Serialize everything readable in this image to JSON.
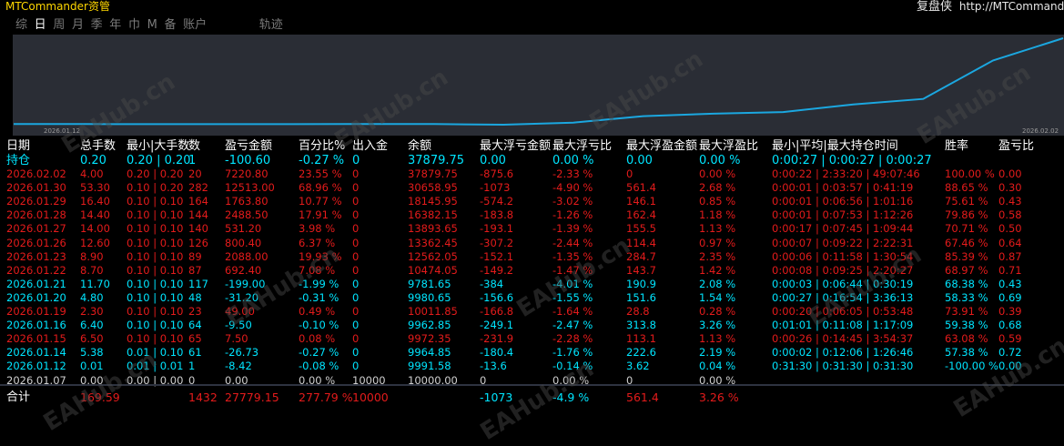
{
  "app": {
    "title": "MTCommander资管"
  },
  "brand": {
    "name": "复盘侠",
    "url": "http://MTCommand"
  },
  "tabs": [
    "综",
    "日",
    "周",
    "月",
    "季",
    "年",
    "巾",
    "M",
    "备",
    "账户"
  ],
  "tabs_active": "日",
  "trail_label": "轨迹",
  "equity_chart": {
    "start_date": "2026.01.12",
    "end_date": "2026.02.02",
    "line_color": "#1ba7e0",
    "points": [
      10000.0,
      9991.58,
      9964.85,
      9972.35,
      9962.85,
      10011.85,
      9980.65,
      9781.65,
      10474.05,
      12562.05,
      13362.45,
      13893.65,
      16382.15,
      18145.95,
      30658.95,
      37879.75
    ]
  },
  "table": {
    "headers": [
      "日期",
      "总手数",
      "最小|大手数",
      "数",
      "盈亏金额",
      "百分比%",
      "出入金",
      "余额",
      "最大浮亏金额",
      "最大浮亏比",
      "最大浮盈金额",
      "最大浮盈比",
      "最小|平均|最大持仓时间",
      "胜率",
      "盈亏比"
    ],
    "holding": {
      "date": "持仓",
      "lots": "0.20",
      "minmax": "0.20 | 0.20",
      "count": "1",
      "pnl": "-100.60",
      "pct": "-0.27 %",
      "flow": "0",
      "balance": "37879.75",
      "max_dd_amt": "0.00",
      "max_dd_pct": "0.00 %",
      "max_fp_amt": "0.00",
      "max_fp_pct": "0.00 %",
      "hold_time": "0:00:27 | 0:00:27 | 0:00:27",
      "win": "",
      "pf": ""
    },
    "rows": [
      {
        "date": "2026.02.02",
        "lots": "4.00",
        "minmax": "0.20 | 0.20",
        "count": "20",
        "pnl": "7220.80",
        "pct": "23.55 %",
        "flow": "0",
        "balance": "37879.75",
        "max_dd_amt": "-875.6",
        "max_dd_pct": "-2.33 %",
        "max_fp_amt": "0",
        "max_fp_pct": "0.00 %",
        "hold_time": "0:00:22 | 2:33:20 | 49:07:46",
        "win": "100.00 %",
        "pf": "0.00",
        "tone": "neg"
      },
      {
        "date": "2026.01.30",
        "lots": "53.30",
        "minmax": "0.10 | 0.20",
        "count": "282",
        "pnl": "12513.00",
        "pct": "68.96 %",
        "flow": "0",
        "balance": "30658.95",
        "max_dd_amt": "-1073",
        "max_dd_pct": "-4.90 %",
        "max_fp_amt": "561.4",
        "max_fp_pct": "2.68 %",
        "hold_time": "0:00:01 | 0:03:57 | 0:41:19",
        "win": "88.65 %",
        "pf": "0.30",
        "tone": "neg"
      },
      {
        "date": "2026.01.29",
        "lots": "16.40",
        "minmax": "0.10 | 0.10",
        "count": "164",
        "pnl": "1763.80",
        "pct": "10.77 %",
        "flow": "0",
        "balance": "18145.95",
        "max_dd_amt": "-574.2",
        "max_dd_pct": "-3.02 %",
        "max_fp_amt": "146.1",
        "max_fp_pct": "0.85 %",
        "hold_time": "0:00:01 | 0:06:56 | 1:01:16",
        "win": "75.61 %",
        "pf": "0.43",
        "tone": "neg"
      },
      {
        "date": "2026.01.28",
        "lots": "14.40",
        "minmax": "0.10 | 0.10",
        "count": "144",
        "pnl": "2488.50",
        "pct": "17.91 %",
        "flow": "0",
        "balance": "16382.15",
        "max_dd_amt": "-183.8",
        "max_dd_pct": "-1.26 %",
        "max_fp_amt": "162.4",
        "max_fp_pct": "1.18 %",
        "hold_time": "0:00:01 | 0:07:53 | 1:12:26",
        "win": "79.86 %",
        "pf": "0.58",
        "tone": "neg"
      },
      {
        "date": "2026.01.27",
        "lots": "14.00",
        "minmax": "0.10 | 0.10",
        "count": "140",
        "pnl": "531.20",
        "pct": "3.98 %",
        "flow": "0",
        "balance": "13893.65",
        "max_dd_amt": "-193.1",
        "max_dd_pct": "-1.39 %",
        "max_fp_amt": "155.5",
        "max_fp_pct": "1.13 %",
        "hold_time": "0:00:17 | 0:07:45 | 1:09:44",
        "win": "70.71 %",
        "pf": "0.50",
        "tone": "neg"
      },
      {
        "date": "2026.01.26",
        "lots": "12.60",
        "minmax": "0.10 | 0.10",
        "count": "126",
        "pnl": "800.40",
        "pct": "6.37 %",
        "flow": "0",
        "balance": "13362.45",
        "max_dd_amt": "-307.2",
        "max_dd_pct": "-2.44 %",
        "max_fp_amt": "114.4",
        "max_fp_pct": "0.97 %",
        "hold_time": "0:00:07 | 0:09:22 | 2:22:31",
        "win": "67.46 %",
        "pf": "0.64",
        "tone": "neg"
      },
      {
        "date": "2026.01.23",
        "lots": "8.90",
        "minmax": "0.10 | 0.10",
        "count": "89",
        "pnl": "2088.00",
        "pct": "19.93 %",
        "flow": "0",
        "balance": "12562.05",
        "max_dd_amt": "-152.1",
        "max_dd_pct": "-1.35 %",
        "max_fp_amt": "284.7",
        "max_fp_pct": "2.35 %",
        "hold_time": "0:00:06 | 0:11:58 | 1:30:54",
        "win": "85.39 %",
        "pf": "0.87",
        "tone": "neg"
      },
      {
        "date": "2026.01.22",
        "lots": "8.70",
        "minmax": "0.10 | 0.10",
        "count": "87",
        "pnl": "692.40",
        "pct": "7.08 %",
        "flow": "0",
        "balance": "10474.05",
        "max_dd_amt": "-149.2",
        "max_dd_pct": "-1.47 %",
        "max_fp_amt": "143.7",
        "max_fp_pct": "1.42 %",
        "hold_time": "0:00:08 | 0:09:25 | 2:20:27",
        "win": "68.97 %",
        "pf": "0.71",
        "tone": "neg"
      },
      {
        "date": "2026.01.21",
        "lots": "11.70",
        "minmax": "0.10 | 0.10",
        "count": "117",
        "pnl": "-199.00",
        "pct": "-1.99 %",
        "flow": "0",
        "balance": "9781.65",
        "max_dd_amt": "-384",
        "max_dd_pct": "-4.01 %",
        "max_fp_amt": "190.9",
        "max_fp_pct": "2.08 %",
        "hold_time": "0:00:03 | 0:06:44 | 0:30:19",
        "win": "68.38 %",
        "pf": "0.43",
        "tone": "pos"
      },
      {
        "date": "2026.01.20",
        "lots": "4.80",
        "minmax": "0.10 | 0.10",
        "count": "48",
        "pnl": "-31.20",
        "pct": "-0.31 %",
        "flow": "0",
        "balance": "9980.65",
        "max_dd_amt": "-156.6",
        "max_dd_pct": "-1.55 %",
        "max_fp_amt": "151.6",
        "max_fp_pct": "1.54 %",
        "hold_time": "0:00:27 | 0:16:54 | 3:36:13",
        "win": "58.33 %",
        "pf": "0.69",
        "tone": "pos"
      },
      {
        "date": "2026.01.19",
        "lots": "2.30",
        "minmax": "0.10 | 0.10",
        "count": "23",
        "pnl": "49.00",
        "pct": "0.49 %",
        "flow": "0",
        "balance": "10011.85",
        "max_dd_amt": "-166.8",
        "max_dd_pct": "-1.64 %",
        "max_fp_amt": "28.8",
        "max_fp_pct": "0.28 %",
        "hold_time": "0:00:20 | 0:06:05 | 0:53:48",
        "win": "73.91 %",
        "pf": "0.39",
        "tone": "neg"
      },
      {
        "date": "2026.01.16",
        "lots": "6.40",
        "minmax": "0.10 | 0.10",
        "count": "64",
        "pnl": "-9.50",
        "pct": "-0.10 %",
        "flow": "0",
        "balance": "9962.85",
        "max_dd_amt": "-249.1",
        "max_dd_pct": "-2.47 %",
        "max_fp_amt": "313.8",
        "max_fp_pct": "3.26 %",
        "hold_time": "0:01:01 | 0:11:08 | 1:17:09",
        "win": "59.38 %",
        "pf": "0.68",
        "tone": "pos"
      },
      {
        "date": "2026.01.15",
        "lots": "6.50",
        "minmax": "0.10 | 0.10",
        "count": "65",
        "pnl": "7.50",
        "pct": "0.08 %",
        "flow": "0",
        "balance": "9972.35",
        "max_dd_amt": "-231.9",
        "max_dd_pct": "-2.28 %",
        "max_fp_amt": "113.1",
        "max_fp_pct": "1.13 %",
        "hold_time": "0:00:26 | 0:14:45 | 3:54:37",
        "win": "63.08 %",
        "pf": "0.59",
        "tone": "neg"
      },
      {
        "date": "2026.01.14",
        "lots": "5.38",
        "minmax": "0.01 | 0.10",
        "count": "61",
        "pnl": "-26.73",
        "pct": "-0.27 %",
        "flow": "0",
        "balance": "9964.85",
        "max_dd_amt": "-180.4",
        "max_dd_pct": "-1.76 %",
        "max_fp_amt": "222.6",
        "max_fp_pct": "2.19 %",
        "hold_time": "0:00:02 | 0:12:06 | 1:26:46",
        "win": "57.38 %",
        "pf": "0.72",
        "tone": "pos"
      },
      {
        "date": "2026.01.12",
        "lots": "0.01",
        "minmax": "0.01 | 0.01",
        "count": "1",
        "pnl": "-8.42",
        "pct": "-0.08 %",
        "flow": "0",
        "balance": "9991.58",
        "max_dd_amt": "-13.6",
        "max_dd_pct": "-0.14 %",
        "max_fp_amt": "3.62",
        "max_fp_pct": "0.04 %",
        "hold_time": "0:31:30 | 0:31:30 | 0:31:30",
        "win": "-100.00 %",
        "pf": "0.00",
        "tone": "pos"
      },
      {
        "date": "2026.01.07",
        "lots": "0.00",
        "minmax": "0.00 | 0.00",
        "count": "0",
        "pnl": "0.00",
        "pct": "0.00 %",
        "flow": "10000",
        "balance": "10000.00",
        "max_dd_amt": "0",
        "max_dd_pct": "0.00 %",
        "max_fp_amt": "0",
        "max_fp_pct": "0.00 %",
        "hold_time": "",
        "win": "",
        "pf": "",
        "tone": "flat"
      }
    ],
    "total": {
      "label": "合计",
      "lots": "169.59",
      "count": "1432",
      "pnl": "27779.15",
      "pct": "277.79 %",
      "flow": "10000",
      "max_dd_amt": "-1073",
      "max_dd_pct": "-4.9 %",
      "max_fp_amt": "561.4",
      "max_fp_pct": "3.26 %"
    }
  },
  "watermark": "EAHub.cn"
}
